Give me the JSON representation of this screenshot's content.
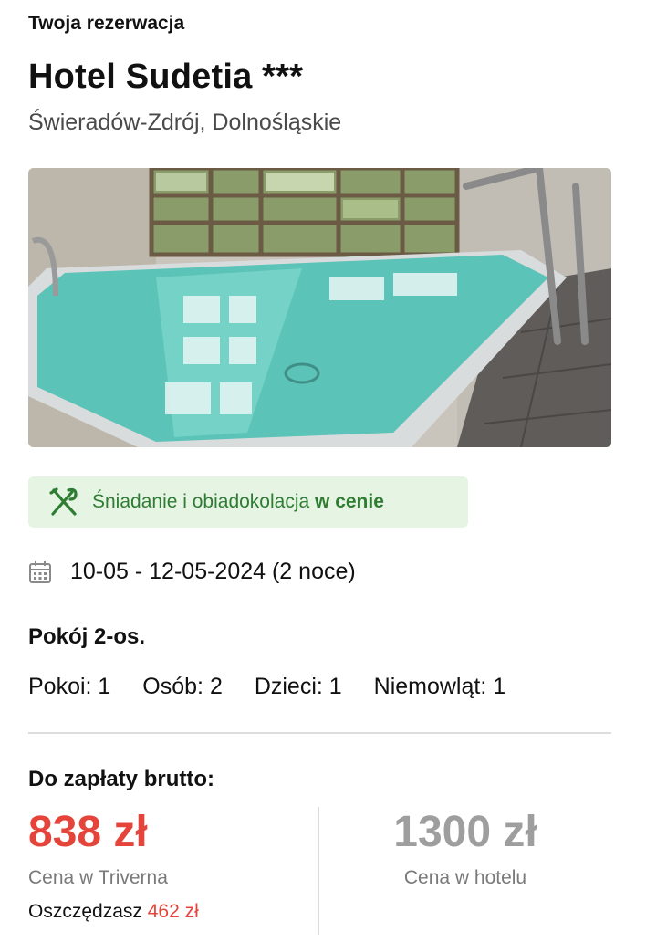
{
  "booking": {
    "kicker": "Twoja rezerwacja",
    "hotel_name": "Hotel Sudetia ***",
    "location": "Świeradów-Zdrój, Dolnośląskie"
  },
  "photo": {
    "icon": "hotel-pool-photo"
  },
  "meal": {
    "icon": "cutlery-icon",
    "text": "Śniadanie i obiadokolacja",
    "highlight": "w cenie",
    "color": "#2e7d32",
    "background": "#e6f4e3"
  },
  "dates": {
    "icon": "calendar-icon",
    "text": "10-05 - 12-05-2024 (2 noce)"
  },
  "room": {
    "title": "Pokój 2-os.",
    "rooms": "Pokoi: 1",
    "persons": "Osób: 2",
    "children": "Dzieci: 1",
    "infants": "Niemowląt: 1"
  },
  "payment": {
    "label": "Do zapłaty brutto:",
    "price": "838 zł",
    "price_caption": "Cena w Triverna",
    "savings_label": "Oszczędzasz",
    "savings_amount": "462 zł",
    "hotel_price": "1300 zł",
    "hotel_price_caption": "Cena w hotelu",
    "accent_color": "#e5443a"
  }
}
